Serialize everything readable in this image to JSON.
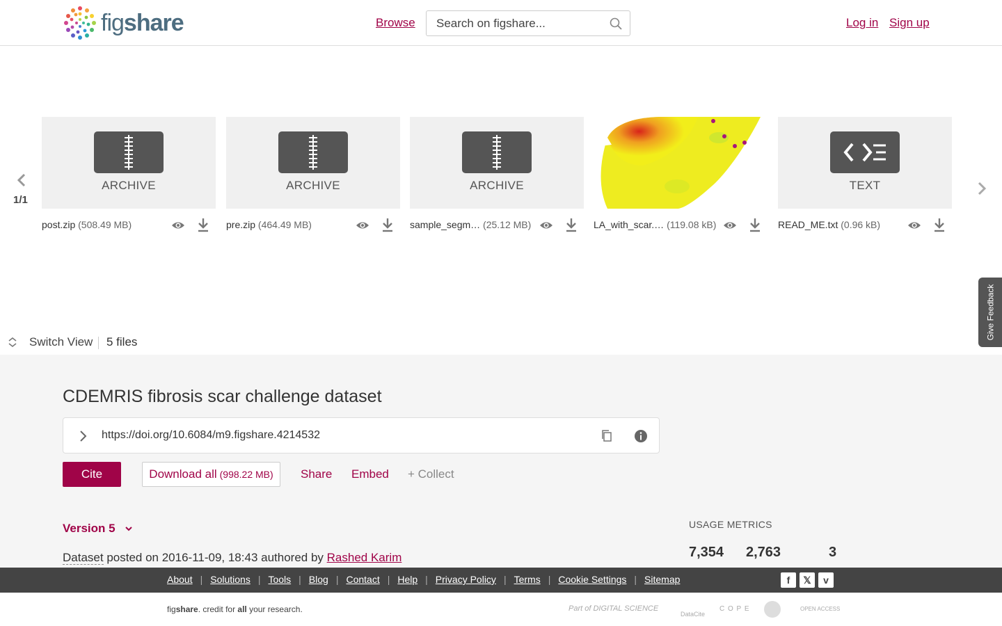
{
  "header": {
    "logo_fig": "fig",
    "logo_share": "share",
    "browse": "Browse",
    "search_placeholder": "Search on figshare...",
    "login": "Log in",
    "signup": "Sign up"
  },
  "carousel": {
    "pager": "1/1",
    "files": [
      {
        "type_label": "ARCHIVE",
        "name": "post.zip",
        "size": "(508.49 MB)",
        "icon": "archive-icon"
      },
      {
        "type_label": "ARCHIVE",
        "name": "pre.zip",
        "size": "(464.49 MB)",
        "icon": "archive-icon"
      },
      {
        "type_label": "ARCHIVE",
        "name": "sample_segm…",
        "size": "(25.12 MB)",
        "icon": "archive-icon"
      },
      {
        "type_label": "",
        "name": "LA_with_scar.…",
        "size": "(119.08 kB)",
        "icon": "image-preview"
      },
      {
        "type_label": "TEXT",
        "name": "READ_ME.txt",
        "size": "(0.96 kB)",
        "icon": "code-icon"
      }
    ]
  },
  "feedback": "Give Feedback",
  "switchbar": {
    "switch_view": "Switch View",
    "files_count": "5 files"
  },
  "item": {
    "title": "CDEMRIS fibrosis scar challenge dataset",
    "doi": "https://doi.org/10.6084/m9.figshare.4214532",
    "cite": "Cite",
    "download_all": "Download all",
    "download_size": "(998.22 MB)",
    "share": "Share",
    "embed": "Embed",
    "collect": "+ Collect",
    "version": "Version 5",
    "posted_type": "Dataset",
    "posted_text": " posted on 2016-11-09, 18:43 authored by ",
    "author": "Rashed Karim"
  },
  "usage": {
    "title": "USAGE METRICS",
    "values": [
      "7,354",
      "2,763",
      "3"
    ]
  },
  "footer": {
    "links": [
      "About",
      "Solutions",
      "Tools",
      "Blog",
      "Contact",
      "Help",
      "Privacy Policy",
      "Terms",
      "Cookie Settings",
      "Sitemap"
    ],
    "social": [
      "facebook-icon",
      "x-icon",
      "vimeo-icon"
    ],
    "tagline_a": "fig",
    "tagline_b": "share",
    "tagline_c": ". credit for ",
    "tagline_d": "all",
    "tagline_e": " your research.",
    "partner_digital_science": "Part of DIGITAL SCIENCE",
    "partner_datacite": "DataCite",
    "partner_cope": "C O P E",
    "partner_open_access": "OPEN ACCESS"
  },
  "colors": {
    "accent": "#a00448",
    "footer_bg": "#444444",
    "details_bg": "#f5f5f5"
  }
}
